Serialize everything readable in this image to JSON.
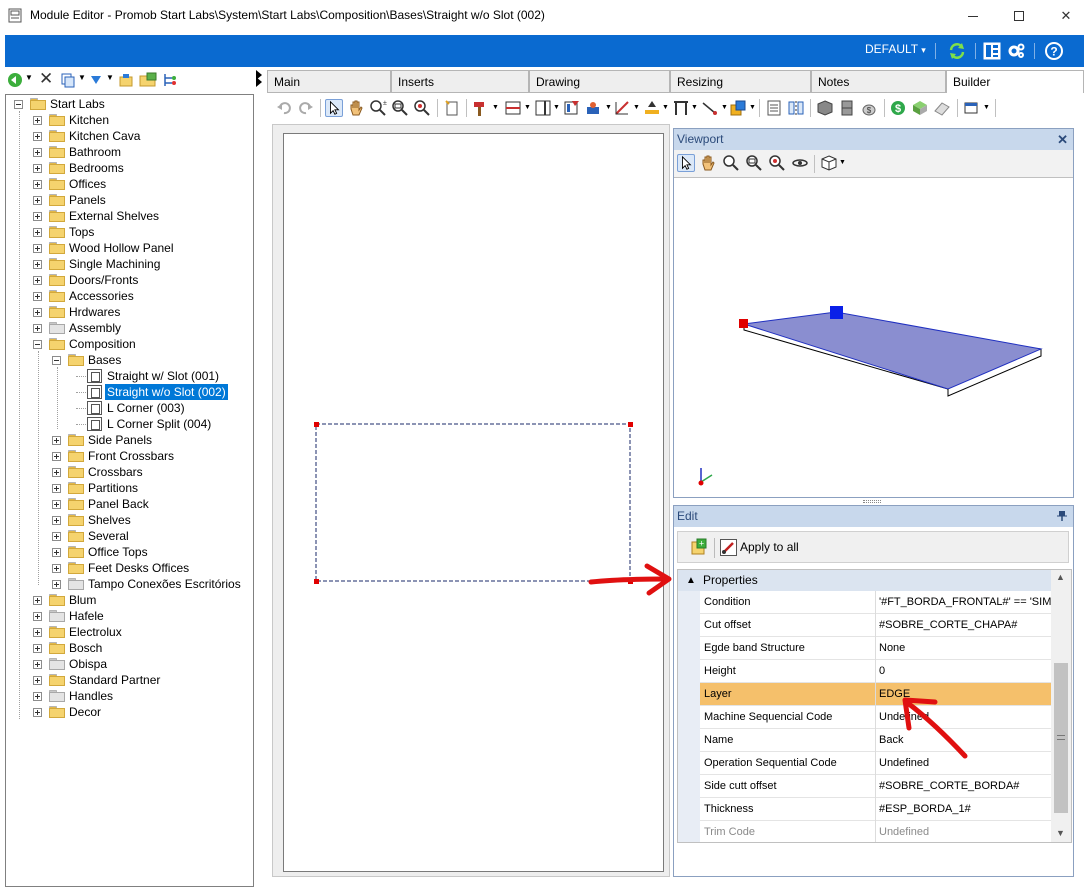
{
  "window": {
    "title": "Module Editor - Promob Start Labs\\System\\Start Labs\\Composition\\Bases\\Straight w/o Slot (002)"
  },
  "topbar": {
    "profile": "DEFAULT",
    "profile_arrow": "▾"
  },
  "tree": {
    "root": "Start Labs",
    "items": [
      {
        "label": "Kitchen"
      },
      {
        "label": "Kitchen Cava"
      },
      {
        "label": "Bathroom"
      },
      {
        "label": "Bedrooms"
      },
      {
        "label": "Offices"
      },
      {
        "label": "Panels"
      },
      {
        "label": "External Shelves"
      },
      {
        "label": "Tops"
      },
      {
        "label": "Wood Hollow Panel"
      },
      {
        "label": "Single Machining"
      },
      {
        "label": "Doors/Fronts"
      },
      {
        "label": "Accessories"
      },
      {
        "label": "Hrdwares"
      },
      {
        "label": "Assembly"
      },
      {
        "label": "Composition"
      }
    ],
    "composition_children": {
      "bases": "Bases",
      "bases_children": [
        {
          "label": "Straight w/ Slot (001)"
        },
        {
          "label": "Straight w/o Slot (002)"
        },
        {
          "label": "L Corner (003)"
        },
        {
          "label": "L Corner Split (004)"
        }
      ],
      "others": [
        {
          "label": "Side Panels"
        },
        {
          "label": "Front Crossbars"
        },
        {
          "label": "Crossbars"
        },
        {
          "label": "Partitions"
        },
        {
          "label": "Panel Back"
        },
        {
          "label": "Shelves"
        },
        {
          "label": "Several"
        },
        {
          "label": "Office Tops"
        },
        {
          "label": "Feet Desks Offices"
        },
        {
          "label": "Tampo Conexões Escritórios"
        }
      ]
    },
    "after": [
      {
        "label": "Blum"
      },
      {
        "label": "Hafele"
      },
      {
        "label": "Electrolux"
      },
      {
        "label": "Bosch"
      },
      {
        "label": "Obispa"
      },
      {
        "label": "Standard Partner"
      },
      {
        "label": "Handles"
      },
      {
        "label": "Decor"
      }
    ]
  },
  "tabs": [
    {
      "label": "Main"
    },
    {
      "label": "Inserts"
    },
    {
      "label": "Drawing"
    },
    {
      "label": "Resizing"
    },
    {
      "label": "Notes"
    },
    {
      "label": "Builder"
    }
  ],
  "viewport": {
    "title": "Viewport",
    "close": "✕"
  },
  "edit": {
    "title": "Edit",
    "apply_all": "Apply to all",
    "category": "Properties",
    "category_caret": "▲",
    "properties": [
      {
        "name": "Condition",
        "value": "'#FT_BORDA_FRONTAL#' == 'SIM'"
      },
      {
        "name": "Cut offset",
        "value": "#SOBRE_CORTE_CHAPA#"
      },
      {
        "name": "Egde band Structure",
        "value": "None"
      },
      {
        "name": "Height",
        "value": "0"
      },
      {
        "name": "Layer",
        "value": "EDGE"
      },
      {
        "name": "Machine Sequencial Code",
        "value": "Undefined"
      },
      {
        "name": "Name",
        "value": "Back"
      },
      {
        "name": "Operation Sequential Code",
        "value": "Undefined"
      },
      {
        "name": "Side cutt offset",
        "value": "#SOBRE_CORTE_BORDA#"
      },
      {
        "name": "Thickness",
        "value": "#ESP_BORDA_1#"
      },
      {
        "name": "Trim Code",
        "value": "Undefined"
      }
    ]
  },
  "colors": {
    "accent_blue": "#0a6ad0",
    "selection": "#0078d7",
    "highlight_row": "#f5c06b",
    "arrow_red": "#e01010",
    "panel_header": "#c8d8ec"
  }
}
